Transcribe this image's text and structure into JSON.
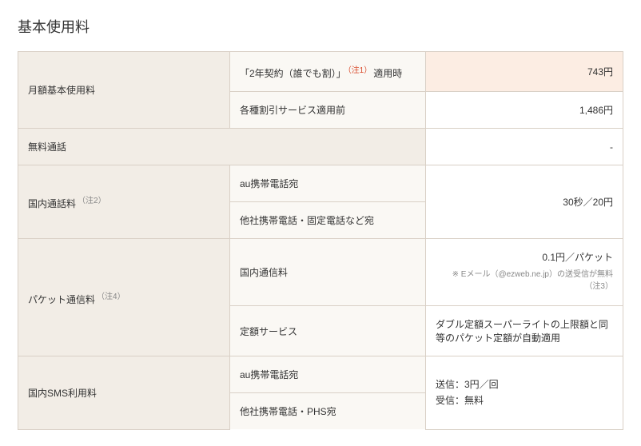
{
  "title": "基本使用料",
  "rows": {
    "monthly": {
      "header": "月額基本使用料",
      "sub1_label_pre": "「2年契約（誰でも割）」",
      "sub1_note": "（注1）",
      "sub1_label_post": "適用時",
      "sub1_value": "743円",
      "sub2_label": "各種割引サービス適用前",
      "sub2_value": "1,486円"
    },
    "free_call": {
      "header": "無料通話",
      "value": "-"
    },
    "domestic_call": {
      "header": "国内通話料",
      "header_note": "（注2）",
      "sub1_label": "au携帯電話宛",
      "sub2_label": "他社携帯電話・固定電話など宛",
      "value": "30秒／20円"
    },
    "packet": {
      "header": "パケット通信料",
      "header_note": "（注4）",
      "sub1_label": "国内通信料",
      "sub1_value": "0.1円／パケット",
      "sub1_subline_pre": "※ Eメール（@ezweb.ne.jp）の送受信が無料",
      "sub1_subline_note": "（注3）",
      "sub2_label": "定額サービス",
      "sub2_value": "ダブル定額スーパーライトの上限額と同等のパケット定額が自動適用"
    },
    "sms": {
      "header": "国内SMS利用料",
      "sub1_label": "au携帯電話宛",
      "sub2_label": "他社携帯電話・PHS宛",
      "value_line1": "送信：3円／回",
      "value_line2": "受信：無料"
    }
  }
}
